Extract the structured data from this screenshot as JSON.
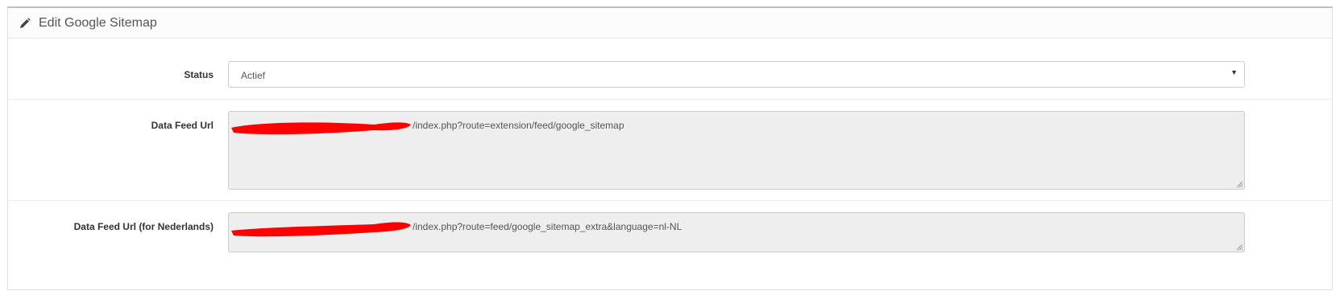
{
  "panel": {
    "title": "Edit Google Sitemap",
    "icon": "pencil-icon"
  },
  "form": {
    "status": {
      "label": "Status",
      "selected": "Actief"
    },
    "data_feed_url": {
      "label": "Data Feed Url",
      "value": "/index.php?route=extension/feed/google_sitemap"
    },
    "data_feed_url_nl": {
      "label": "Data Feed Url (for Nederlands)",
      "value": "/index.php?route=feed/google_sitemap_extra&language=nl-NL"
    }
  },
  "colors": {
    "redaction": "#ff0000",
    "readonly_bg": "#eeeeee",
    "border": "#cccccc"
  }
}
